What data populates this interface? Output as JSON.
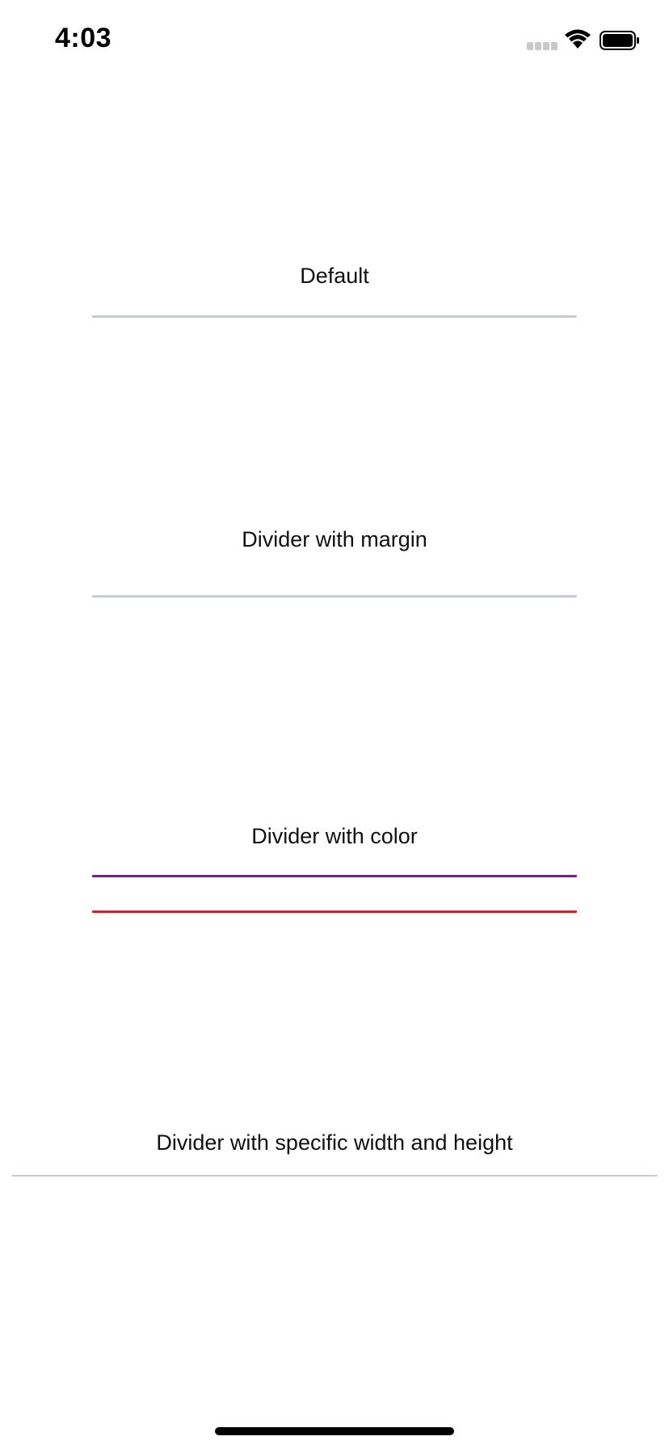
{
  "status_bar": {
    "time": "4:03",
    "signal_icon": "cellular-signal-icon",
    "wifi_icon": "wifi-icon",
    "battery_icon": "battery-icon"
  },
  "sections": [
    {
      "label": "Default",
      "divider_color": "#c6ccd4"
    },
    {
      "label": "Divider with margin",
      "divider_color": "#c6ccd4"
    },
    {
      "label": "Divider with color",
      "divider_color": "#7a1a8e",
      "second_divider_color": "#e21b23"
    },
    {
      "label": "Divider with specific width and height",
      "divider_color": "#c6ccd4"
    }
  ],
  "home_indicator": "home-indicator"
}
